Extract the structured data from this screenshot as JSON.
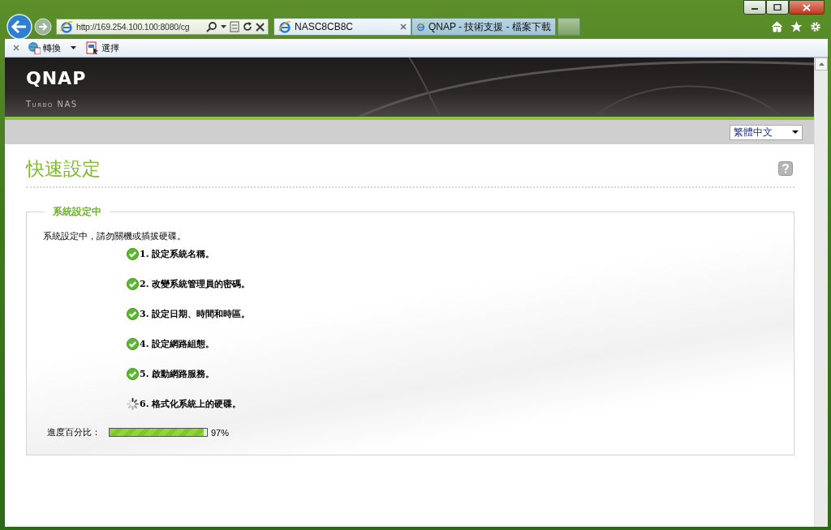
{
  "browser": {
    "address": "http://169.254.100.100:8080/cg",
    "tabs": [
      {
        "label": "NASC8CB8C",
        "selected": true
      },
      {
        "label": "QNAP - 技術支援 - 檔案下載",
        "selected": false
      }
    ],
    "command_bar": [
      {
        "label": "轉換",
        "kind": "convert"
      },
      {
        "label": "選擇",
        "kind": "select"
      }
    ]
  },
  "header": {
    "logo": "QNAP",
    "subtitle": "Turbo NAS",
    "language": "繁體中文"
  },
  "page_title": "快速設定",
  "panel": {
    "legend": "系統設定中",
    "notice": "系統設定中，請勿關機或插拔硬碟。",
    "steps": [
      {
        "text": "1. 設定系統名稱。",
        "kind": "done"
      },
      {
        "text": "2. 改變系統管理員的密碼。",
        "kind": "done"
      },
      {
        "text": "3. 設定日期、時間和時區。",
        "kind": "done"
      },
      {
        "text": "4. 設定網路組態。",
        "kind": "done"
      },
      {
        "text": "5. 啟動網路服務。",
        "kind": "done"
      },
      {
        "text": "6. 格式化系統上的硬碟。",
        "kind": "running"
      }
    ],
    "progress": {
      "label": "進度百分比：",
      "level": 0.97,
      "reading": "97%"
    }
  }
}
